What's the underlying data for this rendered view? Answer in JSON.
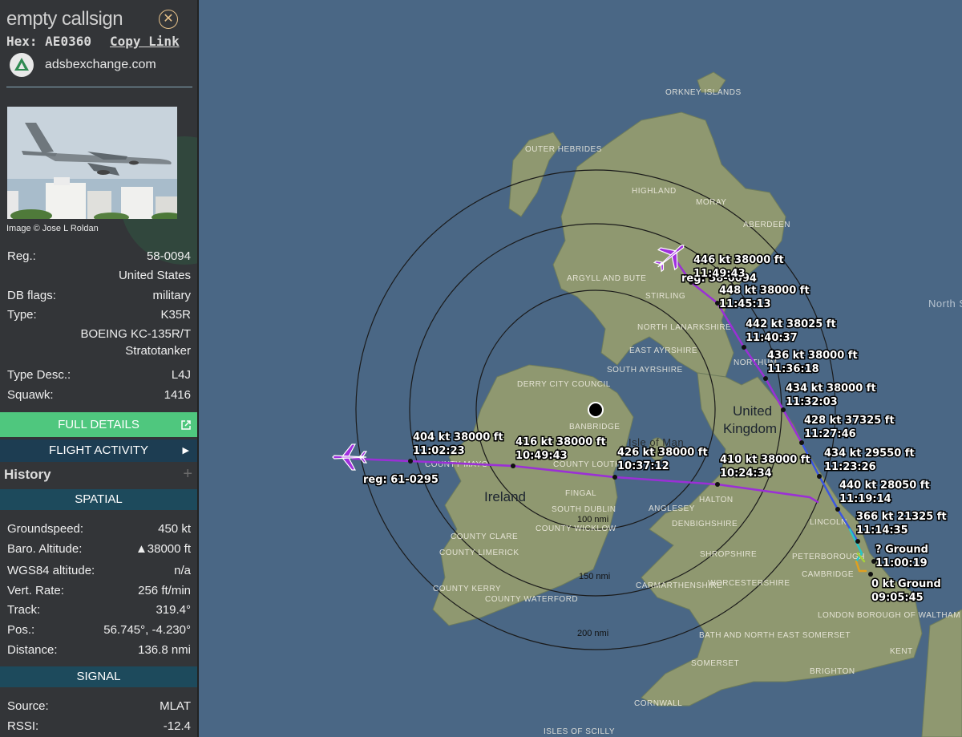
{
  "sidebar": {
    "callsign": "empty callsign",
    "hex_label": "Hex:",
    "hex_value": "AE0360",
    "copy_link": "Copy Link",
    "site": "adsbexchange.com",
    "photo_credit": "Image © Jose L Roldan",
    "reg_label": "Reg.:",
    "reg_value": "58-0094",
    "country": "United States",
    "dbflags_label": "DB flags:",
    "dbflags_value": "military",
    "type_label": "Type:",
    "type_value": "K35R",
    "type_name_1": "BOEING KC-135R/T",
    "type_name_2": "Stratotanker",
    "typedesc_label": "Type Desc.:",
    "typedesc_value": "L4J",
    "squawk_label": "Squawk:",
    "squawk_value": "1416",
    "full_details": "FULL DETAILS",
    "flight_activity": "FLIGHT ACTIVITY",
    "history": "History",
    "spatial_header": "SPATIAL",
    "groundspeed_label": "Groundspeed:",
    "groundspeed_value": "450 kt",
    "baro_label": "Baro. Altitude:",
    "baro_value": "▲38000 ft",
    "wgs_label": "WGS84 altitude:",
    "wgs_value": "n/a",
    "vrate_label": "Vert. Rate:",
    "vrate_value": "256 ft/min",
    "track_label": "Track:",
    "track_value": "319.4°",
    "pos_label": "Pos.:",
    "pos_value": "56.745°, -4.230°",
    "distance_label": "Distance:",
    "distance_value": "136.8 nmi",
    "signal_header": "SIGNAL",
    "source_label": "Source:",
    "source_value": "MLAT",
    "rssi_label": "RSSI:",
    "rssi_value": "-12.4"
  },
  "map": {
    "country_uk_1": "United",
    "country_uk_2": "Kingdom",
    "country_ireland": "Ireland",
    "isle_of_man": "Isle of Man",
    "north_sea": "North S",
    "rings": [
      "100 nmi",
      "150 nmi",
      "200 nmi"
    ],
    "reg_main": "reg: 58-0094",
    "reg_other": "reg: 61-0295",
    "regions": [
      "ORKNEY ISLANDS",
      "OUTER HEBRIDES",
      "HIGHLAND",
      "MORAY",
      "ABERDEEN",
      "ARGYLL AND BUTE",
      "STIRLING",
      "NORTH LANARKSHIRE",
      "EAST AYRSHIRE",
      "SOUTH AYRSHIRE",
      "NORTHUM",
      "DERRY CITY COUNCIL",
      "BANBRIDGE",
      "COUNTY MAYO",
      "COUNTY LOUTH",
      "FINGAL",
      "SOUTH DUBLIN",
      "COUNTY WICKLOW",
      "COUNTY CLARE",
      "COUNTY LIMERICK",
      "COUNTY KERRY",
      "COUNTY WATERFORD",
      "HALTON",
      "ANGLESEY",
      "DENBIGHSHIRE",
      "SHROPSHIRE",
      "WORCESTERSHIRE",
      "CARMARTHENSHIRE",
      "BATH AND NORTH EAST SOMERSET",
      "SOMERSET",
      "CORNWALL",
      "PETERBOROUGH",
      "CAMBRIDGE",
      "LINCOLN",
      "LONDON BOROUGH OF WALTHAM FOREST",
      "KENT",
      "BRIGHTON",
      "ISLES OF SCILLY"
    ],
    "track_labels": [
      {
        "l1": "446 kt  38000 ft",
        "l2": "11:49:43"
      },
      {
        "l1": "448 kt  38000 ft",
        "l2": "11:45:13"
      },
      {
        "l1": "442 kt  38025 ft",
        "l2": "11:40:37"
      },
      {
        "l1": "436 kt  38000 ft",
        "l2": "11:36:18"
      },
      {
        "l1": "434 kt  38000 ft",
        "l2": "11:32:03"
      },
      {
        "l1": "428 kt  37325 ft",
        "l2": "11:27:46"
      },
      {
        "l1": "434 kt  29550 ft",
        "l2": "11:23:26"
      },
      {
        "l1": "440 kt  28050 ft",
        "l2": "11:19:14"
      },
      {
        "l1": "366 kt  21325 ft",
        "l2": "11:14:35"
      },
      {
        "l1": "?  Ground",
        "l2": "11:00:19"
      },
      {
        "l1": "0 kt  Ground",
        "l2": "09:05:45"
      },
      {
        "l1": "404 kt  38000 ft",
        "l2": "11:02:23"
      },
      {
        "l1": "416 kt  38000 ft",
        "l2": "10:49:43"
      },
      {
        "l1": "426 kt  38000 ft",
        "l2": "10:37:12"
      },
      {
        "l1": "410 kt  38000 ft",
        "l2": "10:24:34"
      }
    ]
  }
}
